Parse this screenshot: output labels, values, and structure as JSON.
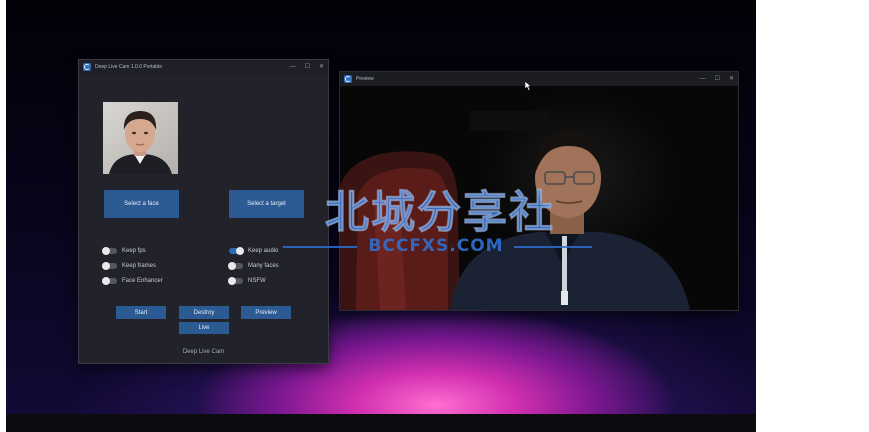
{
  "main_window": {
    "title": "Deep Live Cam 1.0.0 Portable",
    "controls": {
      "minimize": "—",
      "maximize": "☐",
      "close": "✕"
    },
    "buttons": {
      "select_face": "Select a face",
      "select_target": "Select a target",
      "start": "Start",
      "destroy": "Destroy",
      "preview": "Preview",
      "live": "Live"
    },
    "switches": {
      "keep_fps": {
        "label": "Keep fps",
        "on": false
      },
      "keep_frames": {
        "label": "Keep frames",
        "on": false
      },
      "face_enhancer": {
        "label": "Face Enhancer",
        "on": false
      },
      "keep_audio": {
        "label": "Keep audio",
        "on": true
      },
      "many_faces": {
        "label": "Many faces",
        "on": false
      },
      "nsfw": {
        "label": "NSFW",
        "on": false
      }
    },
    "footer": "Deep Live Cam"
  },
  "preview_window": {
    "title": "Preview",
    "controls": {
      "minimize": "—",
      "maximize": "☐",
      "close": "✕"
    }
  },
  "watermark": {
    "main": "北城分享社",
    "sub": "BCCFXS.COM"
  },
  "colors": {
    "accent": "#2c5b93",
    "switch_on": "#2c6bb5",
    "window_bg": "#22232a",
    "watermark": "#2f6fd0"
  },
  "icons": {
    "app_icon": "deep-live-cam-app-icon",
    "cursor": "mouse-cursor-icon"
  }
}
